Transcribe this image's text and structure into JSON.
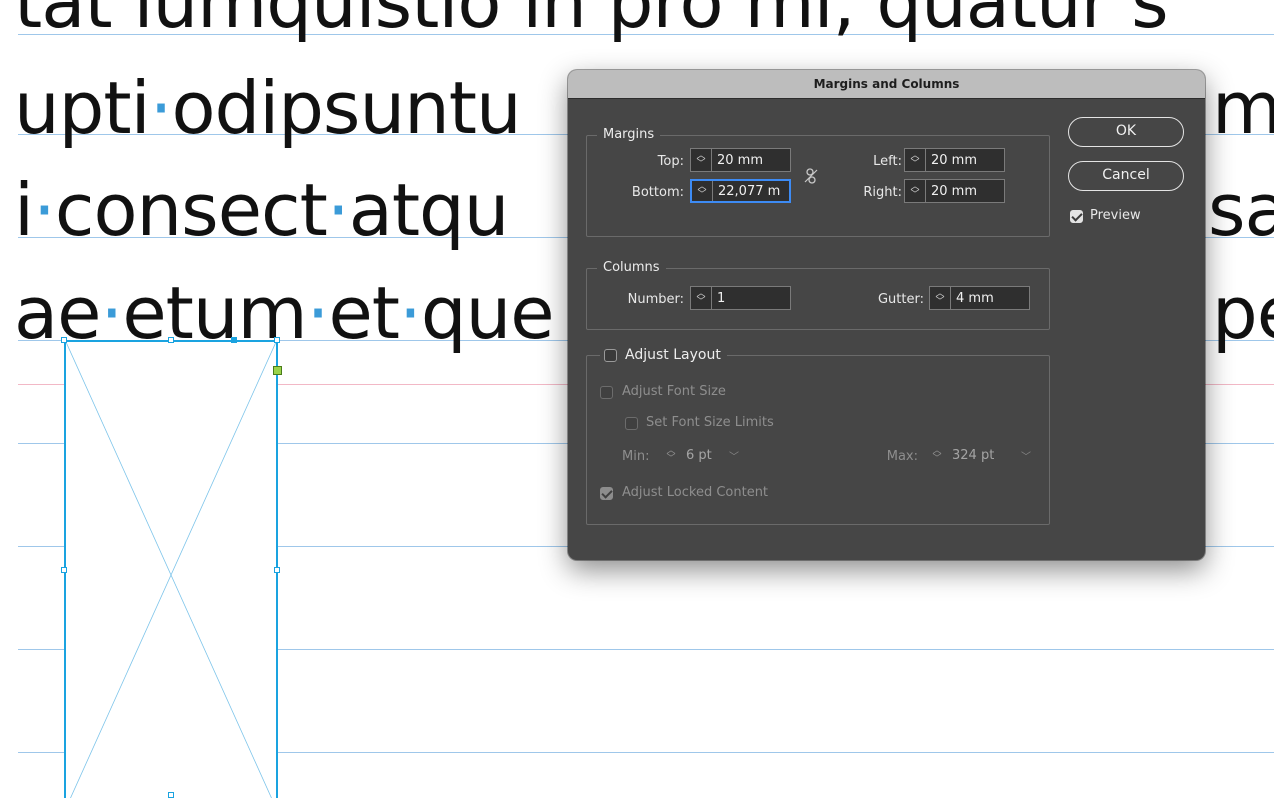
{
  "canvas": {
    "text_lines": [
      {
        "parts": [
          "tat iumquistio in pro mi, quatur s"
        ]
      },
      {
        "parts": [
          "upti",
          "·",
          "odipsuntu",
          "",
          "m",
          "·"
        ]
      },
      {
        "parts": [
          "i",
          "·",
          "consect",
          "·",
          "atqu",
          "",
          "sa"
        ]
      },
      {
        "parts": [
          "ae",
          "·",
          "etum",
          "·",
          "et",
          "·",
          "que",
          "",
          "pe"
        ]
      }
    ]
  },
  "dialog": {
    "title": "Margins and Columns",
    "margins": {
      "group_label": "Margins",
      "top_label": "Top:",
      "top_value": "20 mm",
      "bottom_label": "Bottom:",
      "bottom_value": "22,077 m",
      "left_label": "Left:",
      "left_value": "20 mm",
      "right_label": "Right:",
      "right_value": "20 mm"
    },
    "columns": {
      "group_label": "Columns",
      "number_label": "Number:",
      "number_value": "1",
      "gutter_label": "Gutter:",
      "gutter_value": "4 mm"
    },
    "adjust_layout": {
      "label": "Adjust Layout",
      "checked": false,
      "adjust_font_size_label": "Adjust Font Size",
      "set_font_size_limits_label": "Set Font Size Limits",
      "min_label": "Min:",
      "min_value": "6 pt",
      "max_label": "Max:",
      "max_value": "324 pt",
      "adjust_locked_content_label": "Adjust Locked Content",
      "adjust_locked_content_checked": true
    },
    "buttons": {
      "ok_label": "OK",
      "cancel_label": "Cancel"
    },
    "preview": {
      "label": "Preview",
      "checked": true
    }
  }
}
